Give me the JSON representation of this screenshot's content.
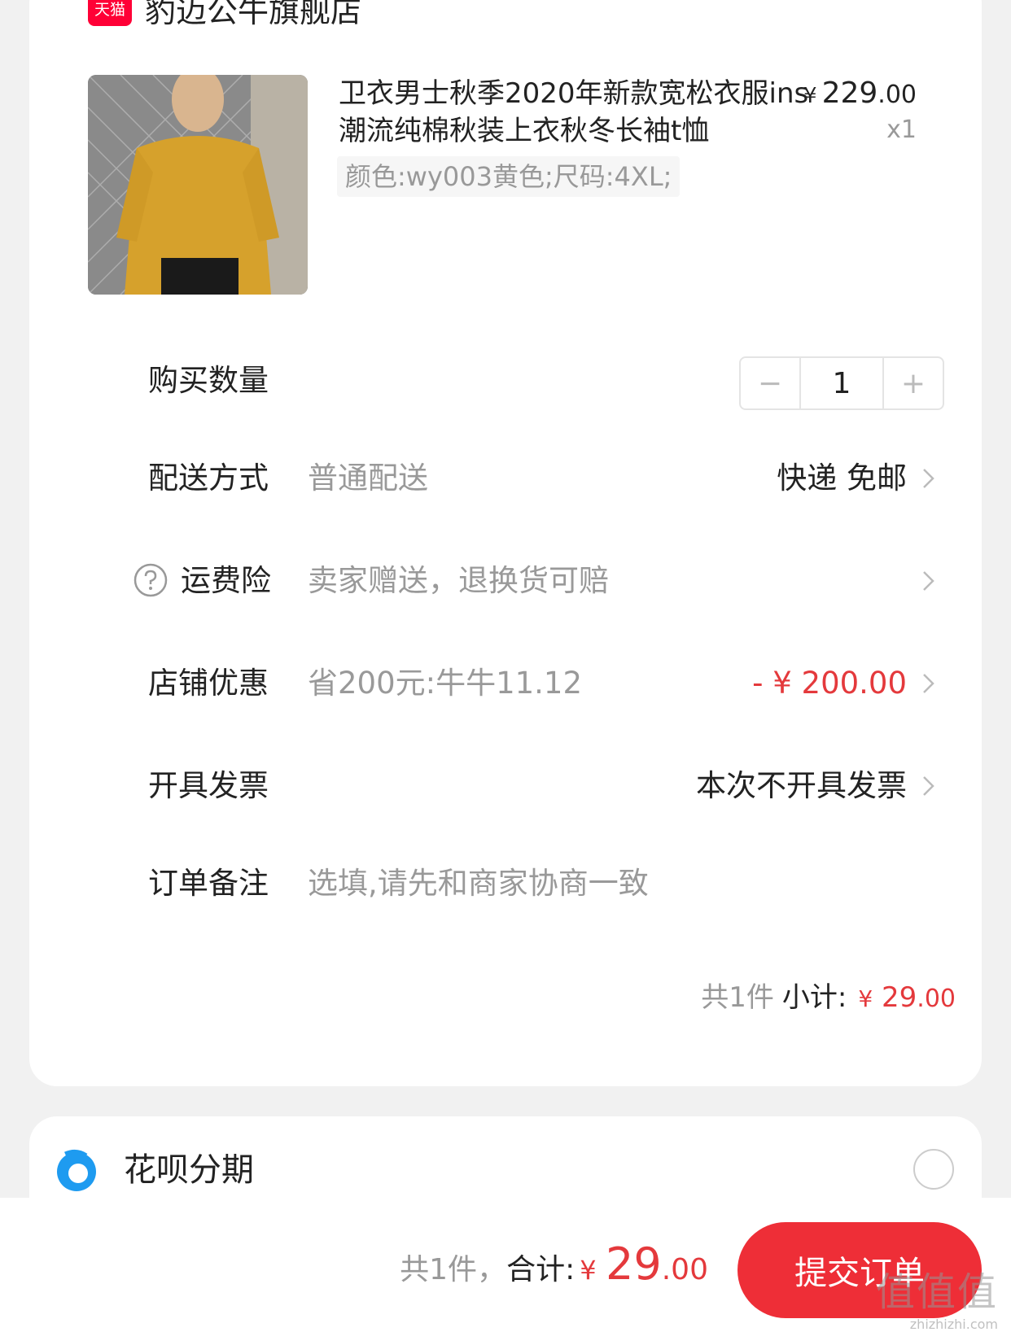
{
  "store": {
    "badge": "天猫",
    "name": "豹迈公牛旗舰店"
  },
  "product": {
    "title": "卫衣男士秋季2020年新款宽松衣服ins潮流纯棉秋装上衣秋冬长袖t恤",
    "sku": "颜色:wy003黄色;尺码:4XL;",
    "price_currency": "¥",
    "price_integer": "229",
    "price_decimal": ".00",
    "quantity_label": "x1",
    "image_desc": "product-photo"
  },
  "rows": {
    "quantity": {
      "label": "购买数量",
      "minus": "−",
      "value": "1",
      "plus": "+"
    },
    "delivery": {
      "label": "配送方式",
      "value": "普通配送",
      "right": "快递 免邮"
    },
    "insurance": {
      "label": "运费险",
      "value": "卖家赠送，退换货可赔"
    },
    "discount": {
      "label": "店铺优惠",
      "value": "省200元:牛牛11.12",
      "right": "- ¥ 200.00"
    },
    "invoice": {
      "label": "开具发票",
      "right": "本次不开具发票"
    },
    "remark": {
      "label": "订单备注",
      "placeholder": "选填,请先和商家协商一致"
    }
  },
  "subtotal": {
    "count": "共1件",
    "label": "小计:",
    "currency": "¥",
    "integer": "29",
    "decimal": ".00"
  },
  "payment": {
    "huabei_label": "花呗分期"
  },
  "bottom": {
    "count": "共1件，",
    "label": "合计:",
    "currency": "¥",
    "integer": "29",
    "decimal": ".00",
    "submit": "提交订单"
  },
  "watermark": {
    "logo": "值值值",
    "url": "zhizhizhi.com"
  },
  "colors": {
    "accent_red": "#e4393c",
    "tmall_red": "#ff0036",
    "submit_red": "#ee2e37",
    "huabei_blue": "#1e9bf0"
  }
}
